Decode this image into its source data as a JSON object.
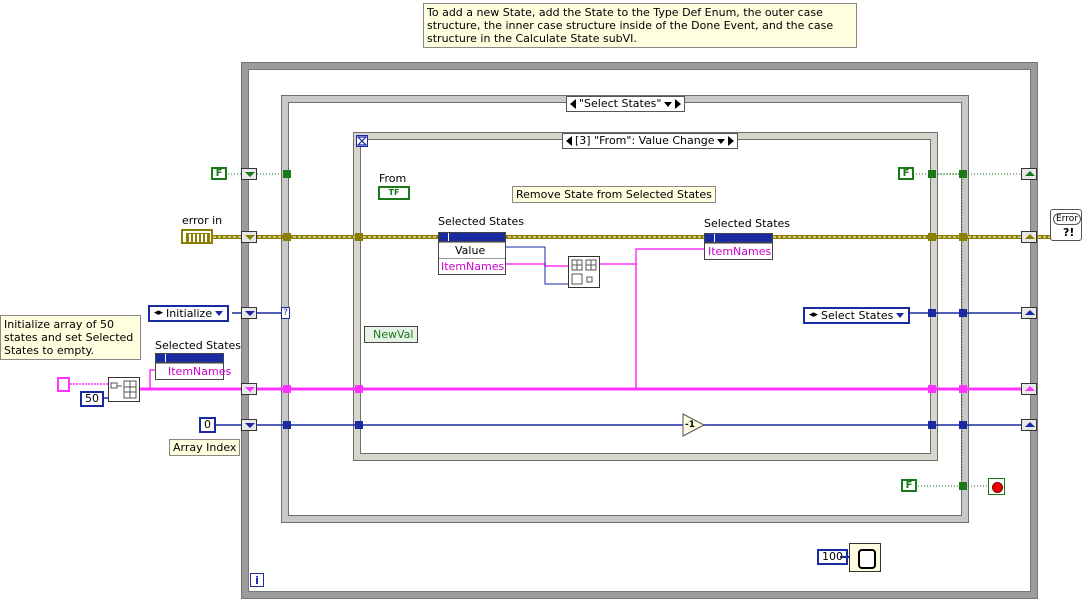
{
  "comments": {
    "top": "To add a new State, add the State to the Type Def Enum, the outer case structure, the inner case structure inside of the Done Event, and the case structure in the Calculate State subVI.",
    "left": "Initialize array of 50 states and set Selected States to empty."
  },
  "case_structure": {
    "selector": "\"Select States\""
  },
  "event_structure": {
    "selector": "[3] \"From\": Value Change"
  },
  "event_data": {
    "from_label": "From",
    "from_terminal": "TF",
    "new_val": "NewVal"
  },
  "labels": {
    "remove_state": "Remove State from Selected States",
    "error_in": "error in",
    "array_index": "Array Index",
    "error_indicator": "Error"
  },
  "property_nodes": {
    "left": {
      "title": "Selected States",
      "rows": [
        "Value",
        "ItemNames"
      ]
    },
    "right": {
      "title": "Selected States",
      "rows": [
        "ItemNames"
      ]
    },
    "init": {
      "title": "Selected States",
      "rows": [
        "ItemNames"
      ]
    }
  },
  "constants": {
    "bool_false": "F",
    "initialize_enum": "Initialize",
    "select_states_enum": "Select States",
    "array_size": "50",
    "array_index_value": "0",
    "wait_ms": "100",
    "decrement": "-1",
    "loop_iteration": "i"
  },
  "colors": {
    "boolean_wire": "#1a7a1a",
    "cluster_wire": "#8a7f00",
    "enum_wire": "#1a2aa0",
    "string_array_wire": "#ff33ff",
    "numeric_wire": "#1a2aa0"
  }
}
